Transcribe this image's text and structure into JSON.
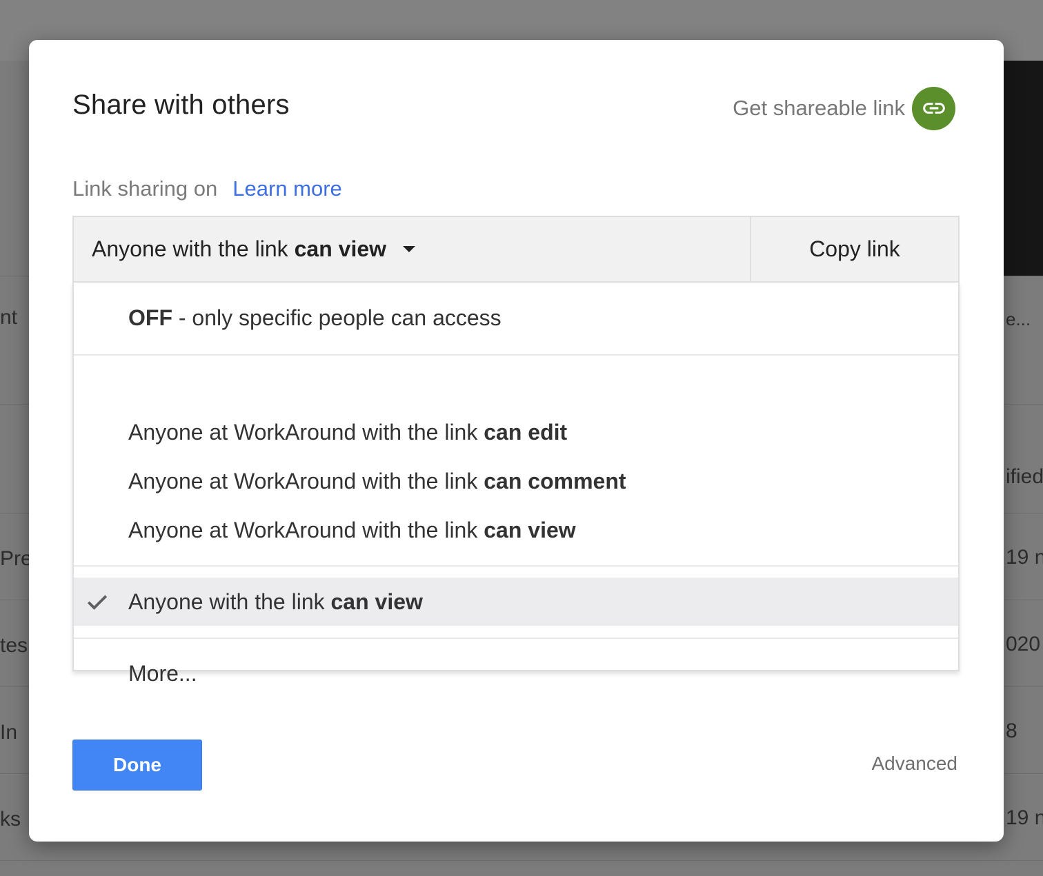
{
  "background": {
    "fragments": [
      "nt",
      "Pre",
      "tes",
      "In",
      "ks",
      "e...",
      "ified",
      "19 n",
      "020",
      "8",
      "19 n"
    ]
  },
  "dialog": {
    "title": "Share with others",
    "shareable_link_label": "Get shareable link",
    "link_icon": "link-icon",
    "link_icon_color": "#5a8f2b",
    "sharing_status": "Link sharing on",
    "learn_more": "Learn more",
    "select": {
      "prefix": "Anyone with the link",
      "emphasis": "can view"
    },
    "copy_link": "Copy link",
    "menu": {
      "off": {
        "emphasis": "OFF",
        "rest": "- only specific people can access"
      },
      "org_items": [
        {
          "prefix": "Anyone at WorkAround with the link",
          "emphasis": "can edit"
        },
        {
          "prefix": "Anyone at WorkAround with the link",
          "emphasis": "can comment"
        },
        {
          "prefix": "Anyone at WorkAround with the link",
          "emphasis": "can view"
        }
      ],
      "public_item": {
        "prefix": "Anyone with the link",
        "emphasis": "can view",
        "selected": true
      },
      "more": "More..."
    },
    "done": "Done",
    "advanced": "Advanced",
    "accent_color": "#4285f4",
    "link_color": "#3d6fe0"
  }
}
